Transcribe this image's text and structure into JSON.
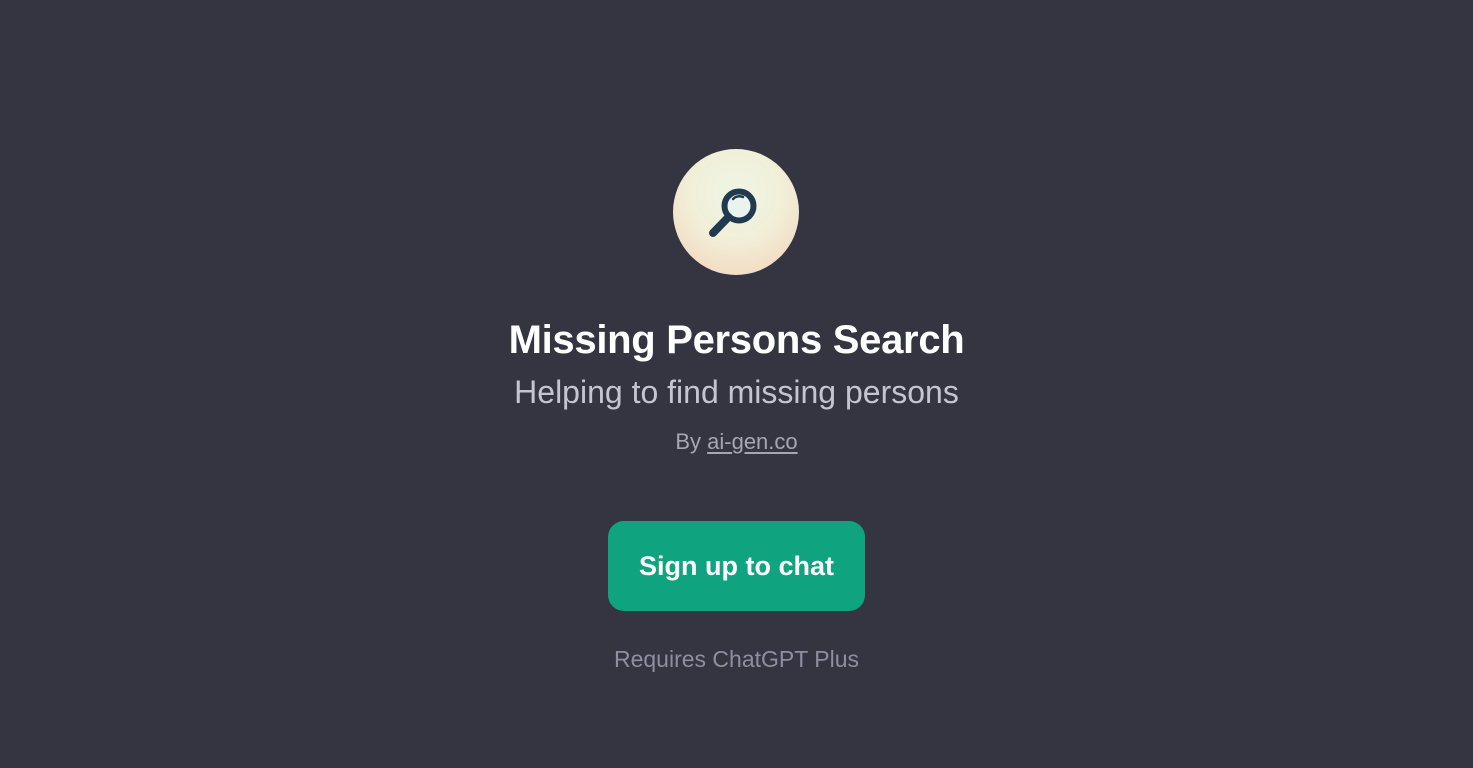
{
  "gpt": {
    "icon": "magnifying-glass-icon",
    "name": "Missing Persons Search",
    "description": "Helping to find missing persons",
    "by_prefix": "By",
    "author": "ai-gen.co"
  },
  "actions": {
    "signup_label": "Sign up to chat",
    "requirement": "Requires ChatGPT Plus"
  },
  "colors": {
    "background": "#343541",
    "accent": "#10a37f",
    "icon": "#1f3b4d"
  }
}
